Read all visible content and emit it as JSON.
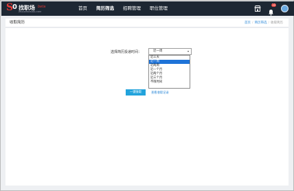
{
  "brand": {
    "logo_s": "S",
    "logo_zero": "0",
    "logo_name": "找职场",
    "logo_tagline": "ZHAOZHICHANG.COM",
    "beta": "beta"
  },
  "nav": {
    "items": [
      {
        "label": "首页"
      },
      {
        "label": "简历筛选"
      },
      {
        "label": "招聘管理"
      },
      {
        "label": "职位管理"
      }
    ]
  },
  "header_icons": {
    "store_icon": "store-icon",
    "bell_icon": "bell-icon",
    "notification_count": "10",
    "avatar_icon": "avatar"
  },
  "titlebar": {
    "title": "收取简历",
    "breadcrumb": [
      "首页",
      "简历筛选",
      "收取简历"
    ]
  },
  "form": {
    "label": "选择简历投递时间：",
    "selected_value": "近一周",
    "options": [
      "近三天",
      "近一周",
      "近两周",
      "近一个月",
      "近两个月",
      "近三个月",
      "不限时间"
    ],
    "selected_index": 1
  },
  "actions": {
    "primary_button": "一键收取",
    "history_link": "查看收取记录"
  },
  "colors": {
    "topbar": "#1d2733",
    "accent": "#22a3dc",
    "link": "#2f8ad8",
    "option_highlight": "#1e73d8",
    "brand_red": "#e53935"
  }
}
